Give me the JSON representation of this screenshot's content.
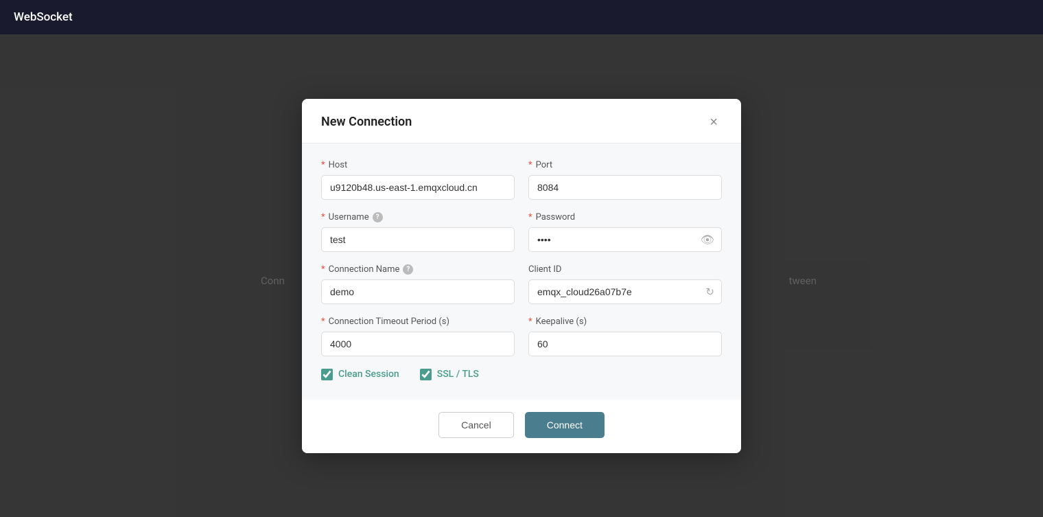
{
  "topbar": {
    "title": "WebSocket"
  },
  "background": {
    "left_text": "Conn",
    "right_text": "tween"
  },
  "dialog": {
    "title": "New Connection",
    "close_label": "×",
    "fields": {
      "host_label": "Host",
      "host_value": "u9120b48.us-east-1.emqxcloud.cn",
      "port_label": "Port",
      "port_value": "8084",
      "username_label": "Username",
      "username_value": "test",
      "password_label": "Password",
      "password_value": "••••",
      "connection_name_label": "Connection Name",
      "connection_name_value": "demo",
      "client_id_label": "Client ID",
      "client_id_value": "emqx_cloud26a07b7e",
      "timeout_label": "Connection Timeout Period (s)",
      "timeout_value": "4000",
      "keepalive_label": "Keepalive (s)",
      "keepalive_value": "60",
      "clean_session_label": "Clean Session",
      "ssl_tls_label": "SSL / TLS"
    },
    "buttons": {
      "cancel_label": "Cancel",
      "connect_label": "Connect"
    }
  }
}
